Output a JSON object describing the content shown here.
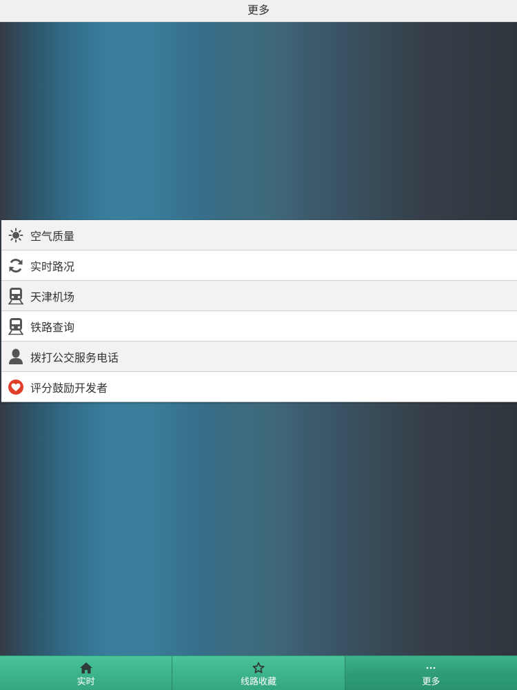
{
  "header": {
    "title": "更多"
  },
  "menu": {
    "items": [
      {
        "label": "空气质量",
        "icon": "sun-icon"
      },
      {
        "label": "实时路况",
        "icon": "refresh-icon"
      },
      {
        "label": "天津机场",
        "icon": "train-icon"
      },
      {
        "label": "铁路查询",
        "icon": "train-icon"
      },
      {
        "label": "拨打公交服务电话",
        "icon": "user-icon"
      },
      {
        "label": "评分鼓励开发者",
        "icon": "heart-icon"
      }
    ]
  },
  "tabbar": {
    "tabs": [
      {
        "label": "实时",
        "icon": "home-icon"
      },
      {
        "label": "线路收藏",
        "icon": "star-icon"
      },
      {
        "label": "更多",
        "icon": "ellipsis-icon",
        "active": true
      }
    ]
  },
  "colors": {
    "tab_green": "#3db48a",
    "heart_red": "#e0402a",
    "icon_gray": "#555555"
  }
}
